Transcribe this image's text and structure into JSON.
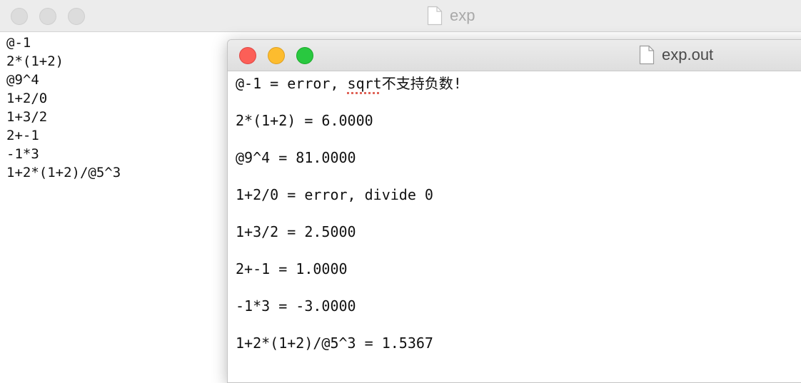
{
  "back_window": {
    "title": "exp",
    "lines": [
      "@-1",
      "2*(1+2)",
      "@9^4",
      "1+2/0",
      "1+3/2",
      "2+-1",
      "-1*3",
      "1+2*(1+2)/@5^3"
    ]
  },
  "front_window": {
    "title": "exp.out",
    "first_line": {
      "before": "@-1 = error, ",
      "misspelled": "sqrt",
      "after": "不支持负数!"
    },
    "lines": [
      "2*(1+2) = 6.0000",
      "@9^4 = 81.0000",
      "1+2/0 = error, divide 0",
      "1+3/2 = 2.5000",
      "2+-1 = 1.0000",
      "-1*3 = -3.0000",
      "1+2*(1+2)/@5^3 = 1.5367"
    ]
  },
  "colors": {
    "close": "#fc5f57",
    "minimize": "#fdbc2e",
    "maximize": "#29c840",
    "spellcheck_underline": "#e0655a"
  },
  "icons": [
    "document-icon"
  ]
}
